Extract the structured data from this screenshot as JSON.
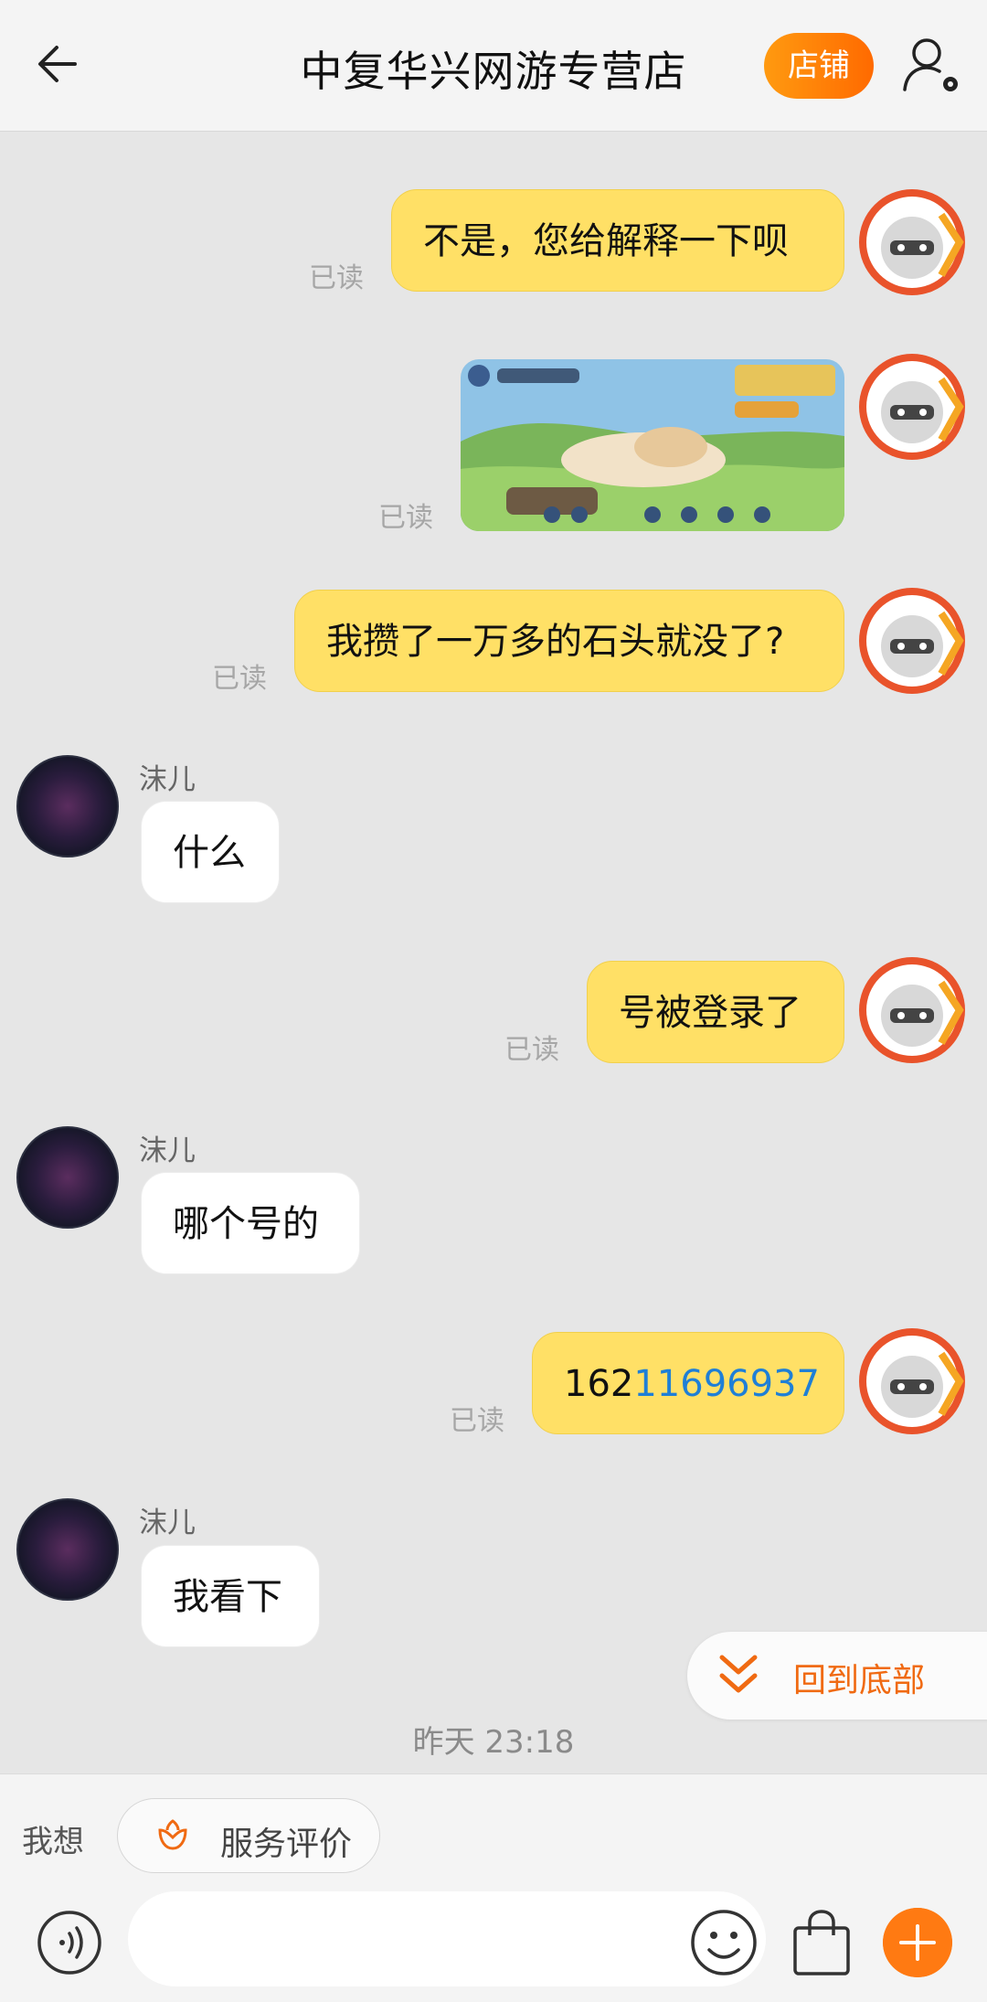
{
  "header": {
    "title": "中复华兴网游专营店",
    "shop_button": "店铺"
  },
  "messages": {
    "m1": {
      "text": "不是，您给解释一下呗",
      "read": "已读"
    },
    "m2": {
      "read": "已读"
    },
    "m3": {
      "text": "我攒了一万多的石头就没了?",
      "read": "已读"
    },
    "m4": {
      "sender": "沫儿",
      "text": "什么"
    },
    "m5": {
      "text": "号被登录了",
      "read": "已读"
    },
    "m6": {
      "sender": "沫儿",
      "text": "哪个号的"
    },
    "m7": {
      "text_prefix": "162",
      "text_link": "11696937",
      "read": "已读"
    },
    "m8": {
      "sender": "沫儿",
      "text": "我看下"
    }
  },
  "back_to_bottom": "回到底部",
  "timestamp": "昨天  23:18",
  "bottom": {
    "i_want": "我想",
    "service_rating": "服务评价"
  },
  "colors": {
    "accent": "#ff7a12",
    "bubble_out": "#ffe066",
    "link": "#1f7fd6"
  }
}
